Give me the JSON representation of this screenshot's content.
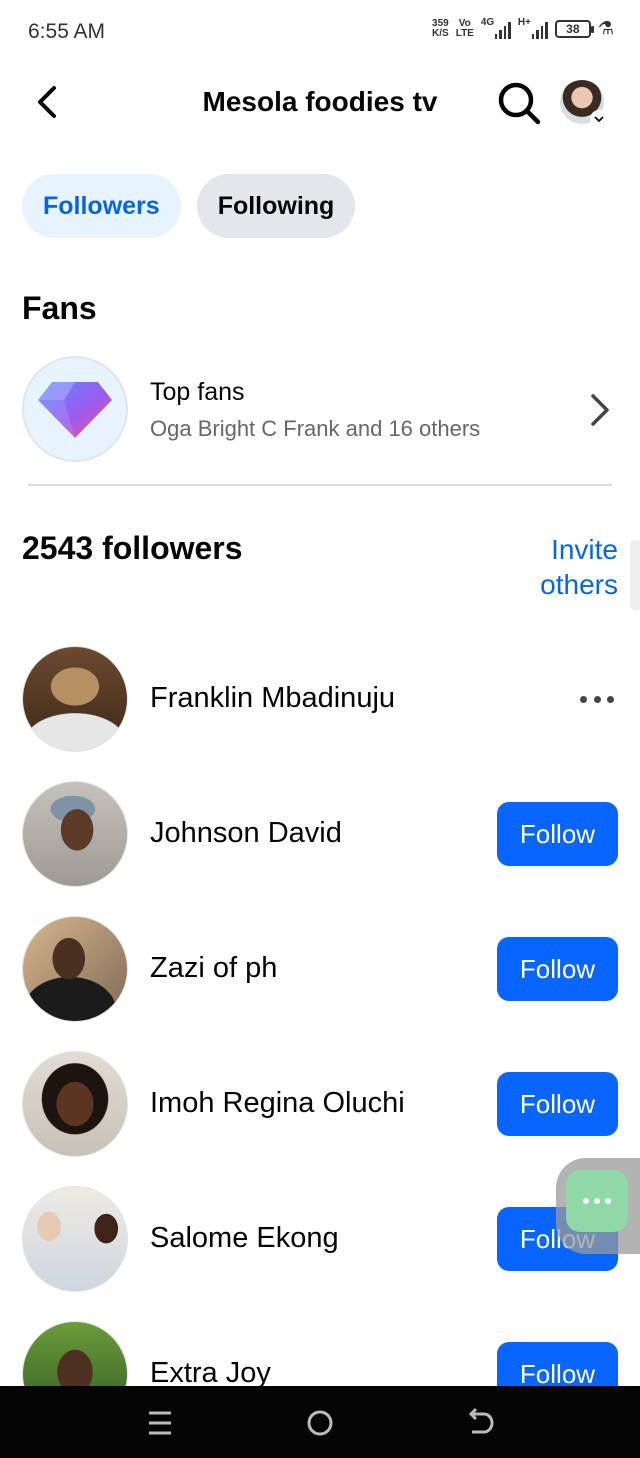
{
  "status_bar": {
    "time": "6:55 AM",
    "net_speed_value": "359",
    "net_speed_unit": "K/S",
    "volte_top": "Vo",
    "volte_bottom": "LTE",
    "signal1_label": "4G",
    "signal2_label": "H+",
    "battery": "38",
    "icons": [
      "signal-icon",
      "battery-icon",
      "flask-icon"
    ]
  },
  "header": {
    "title": "Mesola foodies tv",
    "icons": [
      "back-arrow-icon",
      "search-icon",
      "profile-avatar"
    ]
  },
  "tabs": [
    {
      "label": "Followers",
      "active": true
    },
    {
      "label": "Following",
      "active": false
    }
  ],
  "fans": {
    "section_title": "Fans",
    "top_fans_title": "Top fans",
    "top_fans_subtitle": "Oga Bright C Frank and 16 others",
    "icon": "diamond-icon"
  },
  "followers": {
    "count_label": "2543 followers",
    "invite_line1": "Invite",
    "invite_line2": "others",
    "items": [
      {
        "name": "Franklin Mbadinuju",
        "action": "more"
      },
      {
        "name": "Johnson David",
        "action": "Follow"
      },
      {
        "name": "Zazi of ph",
        "action": "Follow"
      },
      {
        "name": "Imoh Regina Oluchi",
        "action": "Follow"
      },
      {
        "name": "Salome Ekong",
        "action": "Follow"
      },
      {
        "name": "Extra Joy",
        "action": "Follow"
      }
    ]
  },
  "colors": {
    "accent": "#0866ff",
    "accent_text": "#0866d9",
    "active_tab_bg": "#e7f3ff",
    "inactive_tab_bg": "#e4e6eb"
  }
}
